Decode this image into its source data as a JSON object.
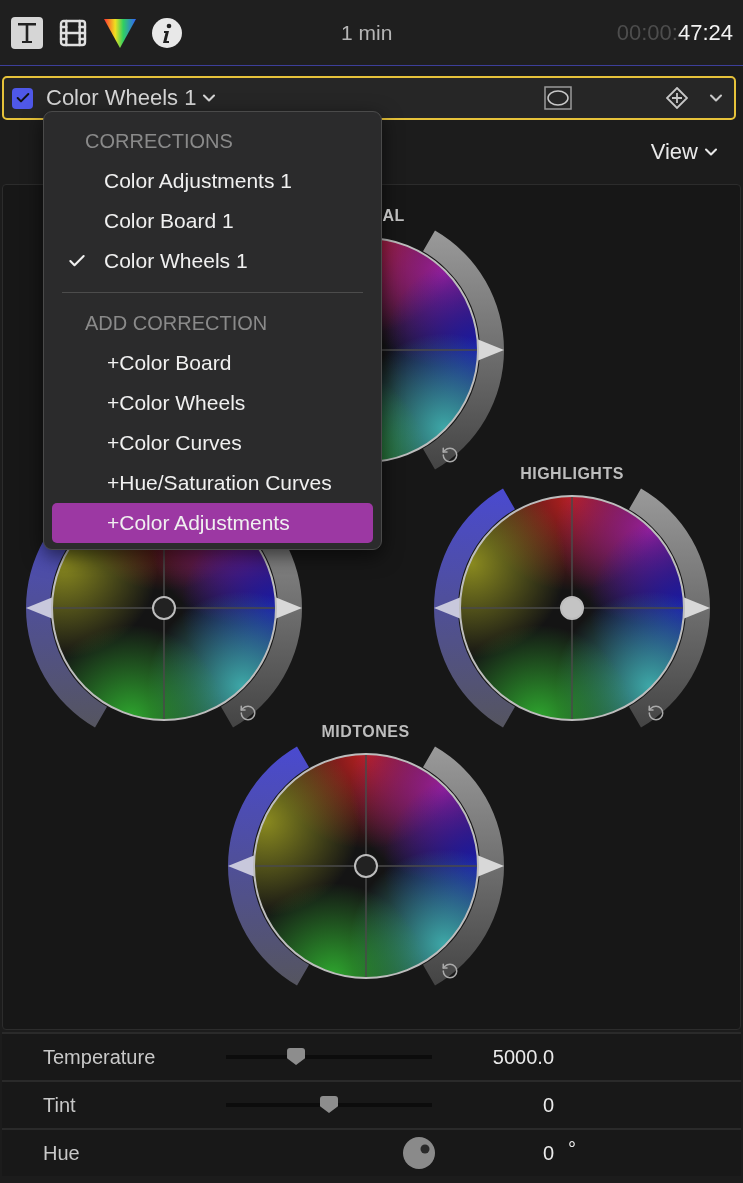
{
  "toolbar": {
    "duration": "1 min",
    "timecode_dim": "00:00:",
    "timecode": "47:24"
  },
  "effect": {
    "name": "Color Wheels 1",
    "enabled": true
  },
  "menu": {
    "sections": [
      {
        "header": "CORRECTIONS",
        "items": [
          {
            "label": "Color Adjustments 1",
            "checked": false,
            "selected": false
          },
          {
            "label": "Color Board 1",
            "checked": false,
            "selected": false
          },
          {
            "label": "Color Wheels 1",
            "checked": true,
            "selected": false
          }
        ]
      },
      {
        "header": "ADD CORRECTION",
        "items": [
          {
            "label": "+Color Board",
            "selected": false
          },
          {
            "label": "+Color Wheels",
            "selected": false
          },
          {
            "label": "+Color Curves",
            "selected": false
          },
          {
            "label": "+Hue/Saturation Curves",
            "selected": false
          },
          {
            "label": "+Color Adjustments",
            "selected": true
          }
        ]
      }
    ]
  },
  "view_button": "View",
  "wheels": [
    {
      "kind": "master",
      "label": "AL",
      "brightness": {
        "level": 0.5
      }
    },
    {
      "kind": "shadows",
      "saturation": {
        "level": 0.5
      },
      "brightness": {
        "level": 0.5
      },
      "puck_filled": false
    },
    {
      "kind": "highlights",
      "label": "HIGHLIGHTS",
      "saturation": {
        "level": 0.5
      },
      "brightness": {
        "level": 0.5
      },
      "puck_filled": true
    },
    {
      "kind": "midtones",
      "label": "MIDTONES",
      "saturation": {
        "level": 0.5
      },
      "brightness": {
        "level": 0.5
      },
      "puck_filled": false
    }
  ],
  "parameters": [
    {
      "kind": "slider",
      "label": "Temperature",
      "level": 0.34,
      "value": "5000.0"
    },
    {
      "kind": "slider",
      "label": "Tint",
      "level": 0.5,
      "value": "0"
    },
    {
      "kind": "dial",
      "label": "Hue",
      "value": "0",
      "unit": "°"
    }
  ]
}
